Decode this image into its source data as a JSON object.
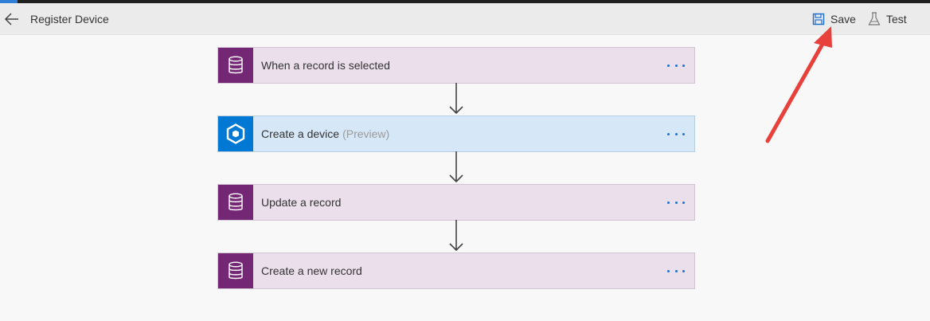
{
  "header": {
    "title": "Register Device",
    "back_icon": "arrow-left-icon",
    "save_label": "Save",
    "save_icon": "floppy-disk-icon",
    "test_label": "Test",
    "test_icon": "flask-icon"
  },
  "steps": [
    {
      "label": "When a record is selected",
      "icon": "database-icon",
      "color": "#742774"
    },
    {
      "label": "Create a device",
      "suffix": "(Preview)",
      "icon": "azure-iot-central-icon",
      "color": "#0078d4"
    },
    {
      "label": "Update a record",
      "icon": "database-icon",
      "color": "#742774"
    },
    {
      "label": "Create a new record",
      "icon": "database-icon",
      "color": "#742774"
    }
  ],
  "colors": {
    "accent": "#1f6fd1",
    "annotation_arrow": "#e8403b"
  }
}
